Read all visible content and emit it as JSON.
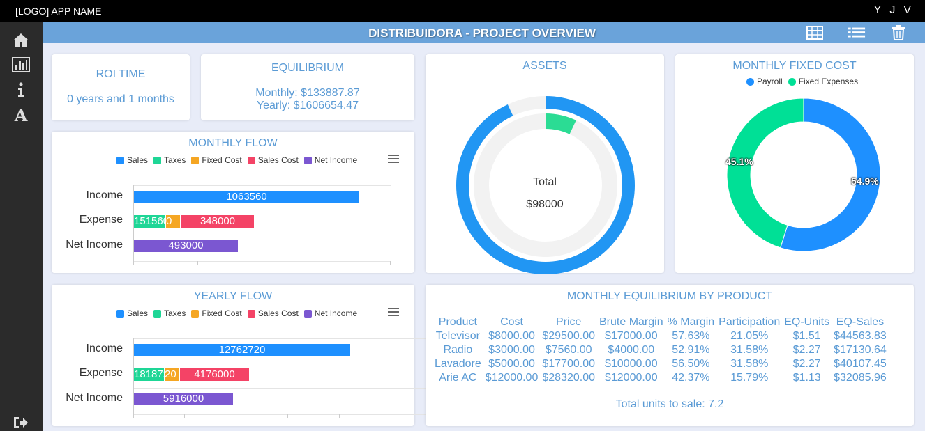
{
  "topbar": {
    "app_name": "[LOGO]  APP NAME",
    "user_initials": [
      "Y",
      "J",
      "V"
    ]
  },
  "header": {
    "title": "DISTRIBUIDORA - PROJECT OVERVIEW"
  },
  "sidebar": {
    "items": [
      {
        "icon": "home-icon"
      },
      {
        "icon": "bar-chart-icon"
      },
      {
        "icon": "info-icon"
      },
      {
        "icon": "font-icon"
      }
    ],
    "logout_icon": "logout-icon"
  },
  "toolbar_icons": [
    "table-icon",
    "list-icon",
    "trash-icon"
  ],
  "roi": {
    "title": "ROI TIME",
    "value": "0 years and 1 months"
  },
  "equilibrium": {
    "title": "EQUILIBRIUM",
    "monthly": "Monthly: $133887.87",
    "yearly": "Yearly: $1606654.47"
  },
  "colors": {
    "sales": "#1e90ff",
    "taxes": "#1ed696",
    "fixed_cost": "#f5a623",
    "sales_cost": "#f44366",
    "net_income": "#7b57d1",
    "payroll": "#1e90ff",
    "fixed_expenses": "#00e096",
    "assets_outer": "#2196f3",
    "assets_inner": "#2bdc94"
  },
  "legend": [
    "Sales",
    "Taxes",
    "Fixed Cost",
    "Sales Cost",
    "Net Income"
  ],
  "monthly_flow": {
    "title": "MONTHLY FLOW",
    "rows": [
      "Income",
      "Expense",
      "Net Income"
    ],
    "labels": {
      "sales": "1063560",
      "taxes": "151560",
      "fixed": "0",
      "sales_cost": "348000",
      "net": "493000"
    }
  },
  "yearly_flow": {
    "title": "YEARLY FLOW",
    "rows": [
      "Income",
      "Expense",
      "Net Income"
    ],
    "labels": {
      "sales": "12762720",
      "taxes": "1818720",
      "fixed": "20",
      "sales_cost": "4176000",
      "net": "5916000"
    }
  },
  "chart_data": [
    {
      "type": "bar",
      "title": "MONTHLY FLOW",
      "categories": [
        "Income",
        "Expense",
        "Net Income"
      ],
      "series": [
        {
          "name": "Sales",
          "values": [
            1063560,
            0,
            0
          ]
        },
        {
          "name": "Taxes",
          "values": [
            0,
            151560,
            0
          ]
        },
        {
          "name": "Fixed Cost",
          "values": [
            0,
            70000,
            0
          ]
        },
        {
          "name": "Sales Cost",
          "values": [
            0,
            348000,
            0
          ]
        },
        {
          "name": "Net Income",
          "values": [
            0,
            0,
            493000
          ]
        }
      ],
      "stacked": true,
      "orientation": "horizontal"
    },
    {
      "type": "bar",
      "title": "YEARLY FLOW",
      "categories": [
        "Income",
        "Expense",
        "Net Income"
      ],
      "series": [
        {
          "name": "Sales",
          "values": [
            12762720,
            0,
            0
          ]
        },
        {
          "name": "Taxes",
          "values": [
            0,
            1818720,
            0
          ]
        },
        {
          "name": "Fixed Cost",
          "values": [
            0,
            840000,
            0
          ]
        },
        {
          "name": "Sales Cost",
          "values": [
            0,
            4176000,
            0
          ]
        },
        {
          "name": "Net Income",
          "values": [
            0,
            0,
            5916000
          ]
        }
      ],
      "stacked": true,
      "orientation": "horizontal"
    },
    {
      "type": "pie",
      "title": "ASSETS",
      "center_label": "Total",
      "center_value": "$98000",
      "rings": [
        {
          "value_fraction": 0.93
        },
        {
          "value_fraction": 0.07
        }
      ]
    },
    {
      "type": "pie",
      "title": "MONTHLY FIXED COST",
      "series": [
        {
          "name": "Payroll",
          "value": 54.9,
          "label": "54.9%"
        },
        {
          "name": "Fixed Expenses",
          "value": 45.1,
          "label": "45.1%"
        }
      ]
    }
  ],
  "assets": {
    "title": "ASSETS",
    "total_label": "Total",
    "total_value": "$98000"
  },
  "fixed_cost": {
    "title": "MONTHLY FIXED COST",
    "legend": [
      "Payroll",
      "Fixed Expenses"
    ],
    "payroll_pct": "54.9%",
    "expenses_pct": "45.1%"
  },
  "product_eq": {
    "title": "MONTHLY EQUILIBRIUM BY PRODUCT",
    "headers": [
      "Product",
      "Cost",
      "Price",
      "Brute Margin",
      "% Margin",
      "Participation",
      "EQ-Units",
      "EQ-Sales"
    ],
    "rows": [
      [
        "Televisor",
        "$8000.00",
        "$29500.00",
        "$17000.00",
        "57.63%",
        "21.05%",
        "$1.51",
        "$44563.83"
      ],
      [
        "Radio",
        "$3000.00",
        "$7560.00",
        "$4000.00",
        "52.91%",
        "31.58%",
        "$2.27",
        "$17130.64"
      ],
      [
        "Lavadore",
        "$5000.00",
        "$17700.00",
        "$10000.00",
        "56.50%",
        "31.58%",
        "$2.27",
        "$40107.45"
      ],
      [
        "Arie AC",
        "$12000.00",
        "$28320.00",
        "$12000.00",
        "42.37%",
        "15.79%",
        "$1.13",
        "$32085.96"
      ]
    ],
    "total": "Total units to sale: 7.2"
  }
}
